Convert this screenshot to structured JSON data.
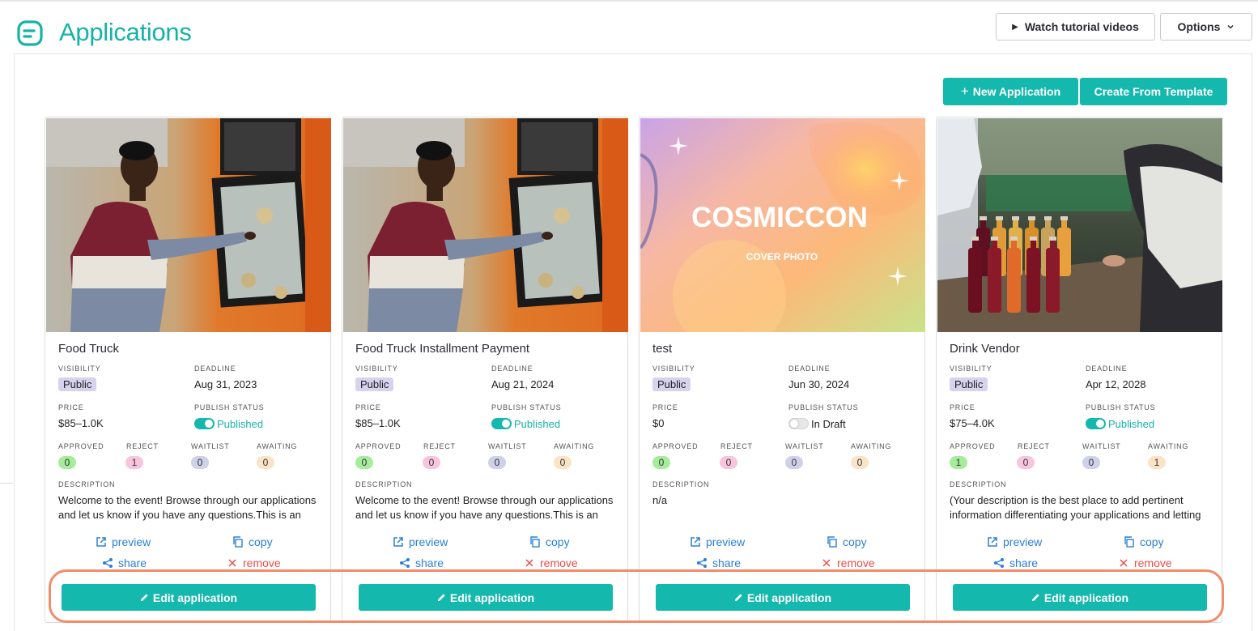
{
  "header": {
    "title": "Applications",
    "watch_label": "Watch tutorial videos",
    "options_label": "Options"
  },
  "toolbar": {
    "new_label": "New Application",
    "template_label": "Create From Template"
  },
  "labels": {
    "visibility": "VISIBILITY",
    "deadline": "DEADLINE",
    "price": "PRICE",
    "publish_status": "PUBLISH STATUS",
    "approved": "APPROVED",
    "reject": "REJECT",
    "waitlist": "WAITLIST",
    "awaiting": "AWAITING",
    "description": "DESCRIPTION",
    "preview": "preview",
    "copy": "copy",
    "share": "share",
    "remove": "remove",
    "edit": "Edit application"
  },
  "cards": [
    {
      "title": "Food Truck",
      "image": "food-truck-photo",
      "visibility": "Public",
      "deadline": "Aug 31, 2023",
      "price": "$85–1.0K",
      "publish_status": "Published",
      "published": true,
      "approved": "0",
      "reject": "1",
      "waitlist": "0",
      "awaiting": "0",
      "description": "Welcome to the event! Browse through our applications and let us know if you have any questions.This is an"
    },
    {
      "title": "Food Truck Installment Payment",
      "image": "food-truck-photo",
      "visibility": "Public",
      "deadline": "Aug 21, 2024",
      "price": "$85–1.0K",
      "publish_status": "Published",
      "published": true,
      "approved": "0",
      "reject": "0",
      "waitlist": "0",
      "awaiting": "0",
      "description": "Welcome to the event! Browse through our applications and let us know if you have any questions.This is an"
    },
    {
      "title": "test",
      "image": "cosmiccon-cover",
      "cover_title": "COSMICCON",
      "cover_subtitle": "COVER PHOTO",
      "visibility": "Public",
      "deadline": "Jun 30, 2024",
      "price": "$0",
      "publish_status": "In Draft",
      "published": false,
      "approved": "0",
      "reject": "0",
      "waitlist": "0",
      "awaiting": "0",
      "description": "n/a"
    },
    {
      "title": "Drink Vendor",
      "image": "drink-vendor-photo",
      "visibility": "Public",
      "deadline": "Apr 12, 2028",
      "price": "$75–4.0K",
      "publish_status": "Published",
      "published": true,
      "approved": "1",
      "reject": "0",
      "waitlist": "0",
      "awaiting": "1",
      "description": "(Your description is the best place to add pertinent information differentiating your applications and letting"
    }
  ],
  "colors": {
    "accent": "#15b8ad",
    "title": "#15b3a7",
    "remove": "#e84c4c",
    "link": "#2b7fd9",
    "highlight": "#f08c6a"
  }
}
